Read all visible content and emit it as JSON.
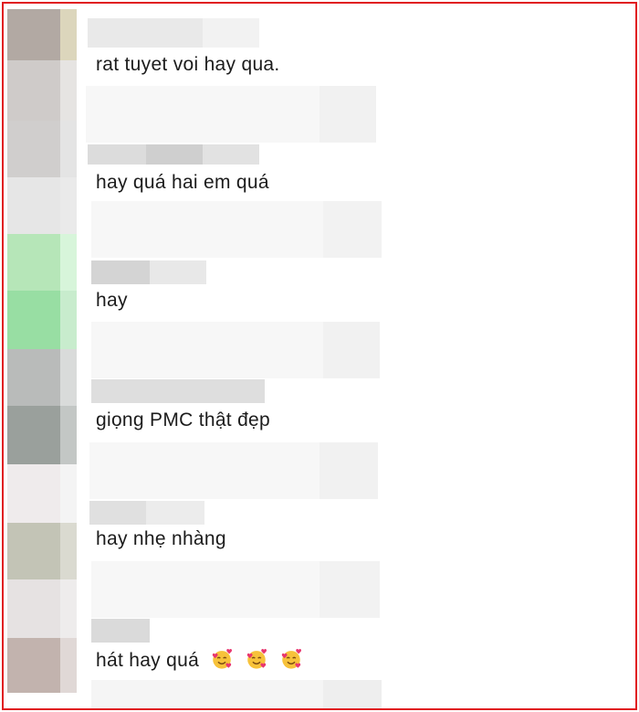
{
  "comments": [
    {
      "text": "rat tuyet voi hay qua."
    },
    {
      "text": "hay quá hai em quá"
    },
    {
      "text": "hay"
    },
    {
      "text": "giọng PMC thật đẹp"
    },
    {
      "text": "hay nhẹ nhàng"
    },
    {
      "text": "hát hay quá",
      "emojis": [
        "smiling-face-with-hearts-icon",
        "smiling-face-with-hearts-icon",
        "smiling-face-with-hearts-icon"
      ]
    }
  ],
  "colors": {
    "frame_border": "#e0191f",
    "text": "#1c1c1c"
  }
}
